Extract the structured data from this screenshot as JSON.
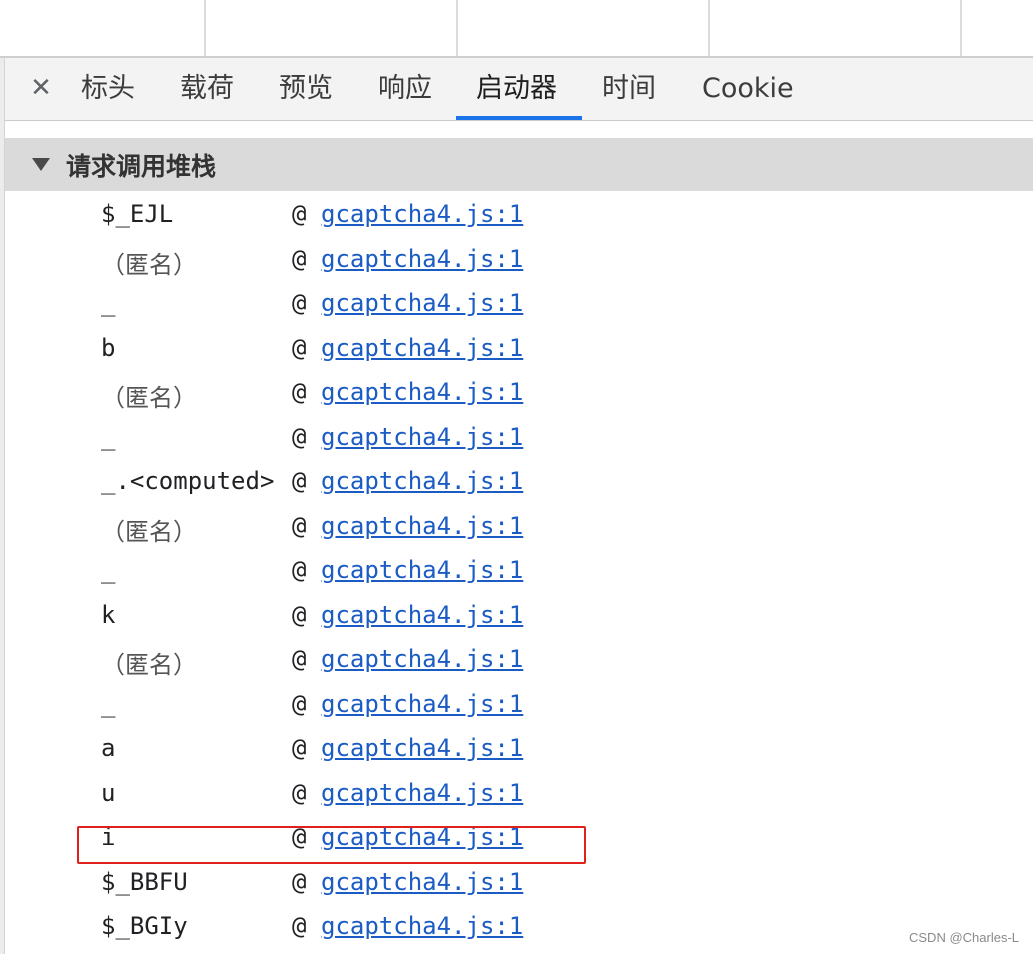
{
  "tabs": [
    {
      "label": "标头",
      "active": false
    },
    {
      "label": "载荷",
      "active": false
    },
    {
      "label": "预览",
      "active": false
    },
    {
      "label": "响应",
      "active": false
    },
    {
      "label": "启动器",
      "active": true
    },
    {
      "label": "时间",
      "active": false
    },
    {
      "label": "Cookie",
      "active": false
    }
  ],
  "close_icon": "✕",
  "section": {
    "title": "请求调用堆栈",
    "expanded": true
  },
  "stack": [
    {
      "name": "$_EJL",
      "at": "@",
      "link": "gcaptcha4.js:1"
    },
    {
      "name": "（匿名）",
      "at": "@",
      "link": "gcaptcha4.js:1"
    },
    {
      "name": "_",
      "at": "@",
      "link": "gcaptcha4.js:1"
    },
    {
      "name": "b",
      "at": "@",
      "link": "gcaptcha4.js:1"
    },
    {
      "name": "（匿名）",
      "at": "@",
      "link": "gcaptcha4.js:1"
    },
    {
      "name": "_",
      "at": "@",
      "link": "gcaptcha4.js:1"
    },
    {
      "name": "_.<computed>",
      "at": "@",
      "link": "gcaptcha4.js:1"
    },
    {
      "name": "（匿名）",
      "at": "@",
      "link": "gcaptcha4.js:1"
    },
    {
      "name": "_",
      "at": "@",
      "link": "gcaptcha4.js:1"
    },
    {
      "name": "k",
      "at": "@",
      "link": "gcaptcha4.js:1"
    },
    {
      "name": "（匿名）",
      "at": "@",
      "link": "gcaptcha4.js:1"
    },
    {
      "name": "_",
      "at": "@",
      "link": "gcaptcha4.js:1"
    },
    {
      "name": "a",
      "at": "@",
      "link": "gcaptcha4.js:1"
    },
    {
      "name": "u",
      "at": "@",
      "link": "gcaptcha4.js:1"
    },
    {
      "name": "i",
      "at": "@",
      "link": "gcaptcha4.js:1"
    },
    {
      "name": "$_BBFU",
      "at": "@",
      "link": "gcaptcha4.js:1"
    },
    {
      "name": "$_BGIy",
      "at": "@",
      "link": "gcaptcha4.js:1"
    }
  ],
  "watermark": "CSDN @Charles-L",
  "colors": {
    "accent": "#1a73e8",
    "link": "#1a5bc4",
    "highlight": "#e0201b",
    "header_bg": "#dadada",
    "tabbar_bg": "#f3f3f3"
  }
}
